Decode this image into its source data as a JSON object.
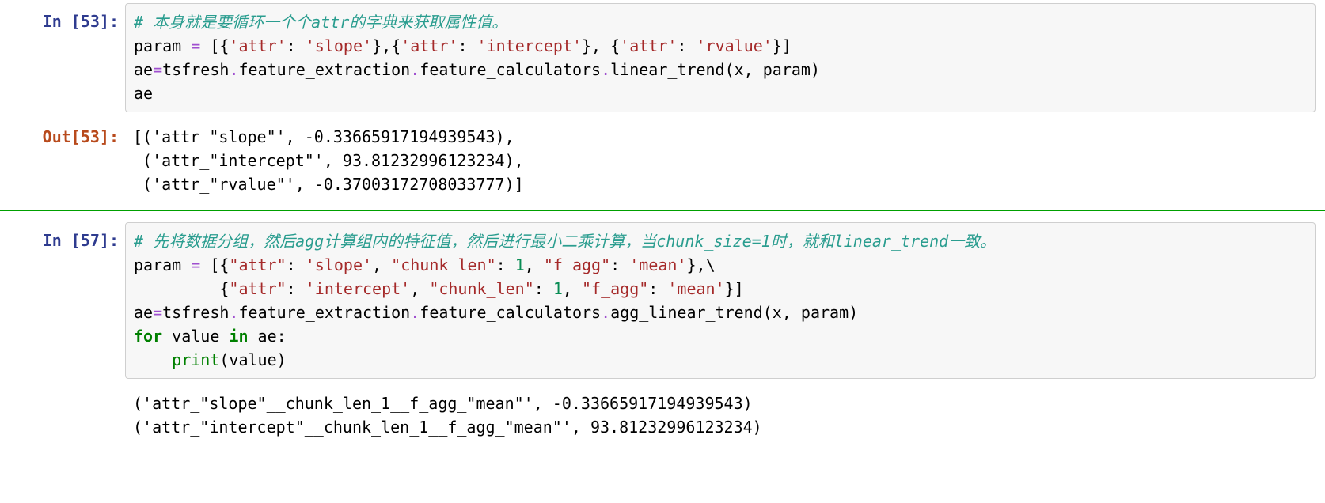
{
  "cells": [
    {
      "type": "in",
      "exec_count": 53,
      "lines": [
        [
          {
            "cls": "tok-comment",
            "text": "# 本身就是要循环一个个attr的字典来获取属性值。"
          }
        ],
        [
          {
            "cls": "",
            "text": "param "
          },
          {
            "cls": "tok-op",
            "text": "="
          },
          {
            "cls": "",
            "text": " [{"
          },
          {
            "cls": "tok-string",
            "text": "'attr'"
          },
          {
            "cls": "",
            "text": ": "
          },
          {
            "cls": "tok-string",
            "text": "'slope'"
          },
          {
            "cls": "",
            "text": "},{"
          },
          {
            "cls": "tok-string",
            "text": "'attr'"
          },
          {
            "cls": "",
            "text": ": "
          },
          {
            "cls": "tok-string",
            "text": "'intercept'"
          },
          {
            "cls": "",
            "text": "}, {"
          },
          {
            "cls": "tok-string",
            "text": "'attr'"
          },
          {
            "cls": "",
            "text": ": "
          },
          {
            "cls": "tok-string",
            "text": "'rvalue'"
          },
          {
            "cls": "",
            "text": "}]"
          }
        ],
        [
          {
            "cls": "",
            "text": "ae"
          },
          {
            "cls": "tok-op",
            "text": "="
          },
          {
            "cls": "",
            "text": "tsfresh"
          },
          {
            "cls": "tok-op",
            "text": "."
          },
          {
            "cls": "",
            "text": "feature_extraction"
          },
          {
            "cls": "tok-op",
            "text": "."
          },
          {
            "cls": "",
            "text": "feature_calculators"
          },
          {
            "cls": "tok-op",
            "text": "."
          },
          {
            "cls": "",
            "text": "linear_trend(x, param)"
          }
        ],
        [
          {
            "cls": "",
            "text": "ae"
          }
        ]
      ]
    },
    {
      "type": "out",
      "exec_count": 53,
      "plain_lines": [
        "[('attr_\"slope\"', -0.33665917194939543),",
        " ('attr_\"intercept\"', 93.81232996123234),",
        " ('attr_\"rvalue\"', -0.37003172708033777)]"
      ]
    },
    {
      "type": "divider"
    },
    {
      "type": "in",
      "exec_count": 57,
      "lines": [
        [
          {
            "cls": "tok-comment",
            "text": "# 先将数据分组，然后agg计算组内的特征值，然后进行最小二乘计算，当chunk_size=1时，就和linear_trend一致。"
          }
        ],
        [
          {
            "cls": "",
            "text": "param "
          },
          {
            "cls": "tok-op",
            "text": "="
          },
          {
            "cls": "",
            "text": " [{"
          },
          {
            "cls": "tok-string",
            "text": "\"attr\""
          },
          {
            "cls": "",
            "text": ": "
          },
          {
            "cls": "tok-string",
            "text": "'slope'"
          },
          {
            "cls": "",
            "text": ", "
          },
          {
            "cls": "tok-string",
            "text": "\"chunk_len\""
          },
          {
            "cls": "",
            "text": ": "
          },
          {
            "cls": "tok-num",
            "text": "1"
          },
          {
            "cls": "",
            "text": ", "
          },
          {
            "cls": "tok-string",
            "text": "\"f_agg\""
          },
          {
            "cls": "",
            "text": ": "
          },
          {
            "cls": "tok-string",
            "text": "'mean'"
          },
          {
            "cls": "",
            "text": "},\\"
          }
        ],
        [
          {
            "cls": "",
            "text": "         {"
          },
          {
            "cls": "tok-string",
            "text": "\"attr\""
          },
          {
            "cls": "",
            "text": ": "
          },
          {
            "cls": "tok-string",
            "text": "'intercept'"
          },
          {
            "cls": "",
            "text": ", "
          },
          {
            "cls": "tok-string",
            "text": "\"chunk_len\""
          },
          {
            "cls": "",
            "text": ": "
          },
          {
            "cls": "tok-num",
            "text": "1"
          },
          {
            "cls": "",
            "text": ", "
          },
          {
            "cls": "tok-string",
            "text": "\"f_agg\""
          },
          {
            "cls": "",
            "text": ": "
          },
          {
            "cls": "tok-string",
            "text": "'mean'"
          },
          {
            "cls": "",
            "text": "}]"
          }
        ],
        [
          {
            "cls": "",
            "text": "ae"
          },
          {
            "cls": "tok-op",
            "text": "="
          },
          {
            "cls": "",
            "text": "tsfresh"
          },
          {
            "cls": "tok-op",
            "text": "."
          },
          {
            "cls": "",
            "text": "feature_extraction"
          },
          {
            "cls": "tok-op",
            "text": "."
          },
          {
            "cls": "",
            "text": "feature_calculators"
          },
          {
            "cls": "tok-op",
            "text": "."
          },
          {
            "cls": "",
            "text": "agg_linear_trend(x, param)"
          }
        ],
        [
          {
            "cls": "tok-kw",
            "text": "for"
          },
          {
            "cls": "",
            "text": " value "
          },
          {
            "cls": "tok-kw",
            "text": "in"
          },
          {
            "cls": "",
            "text": " ae:"
          }
        ],
        [
          {
            "cls": "",
            "text": "    "
          },
          {
            "cls": "tok-builtin",
            "text": "print"
          },
          {
            "cls": "",
            "text": "(value)"
          }
        ]
      ]
    },
    {
      "type": "out",
      "exec_count": null,
      "plain_lines": [
        "('attr_\"slope\"__chunk_len_1__f_agg_\"mean\"', -0.33665917194939543)",
        "('attr_\"intercept\"__chunk_len_1__f_agg_\"mean\"', 93.81232996123234)"
      ]
    }
  ],
  "prompt_templates": {
    "in": "In [{n}]:",
    "out": "Out[{n}]:"
  }
}
